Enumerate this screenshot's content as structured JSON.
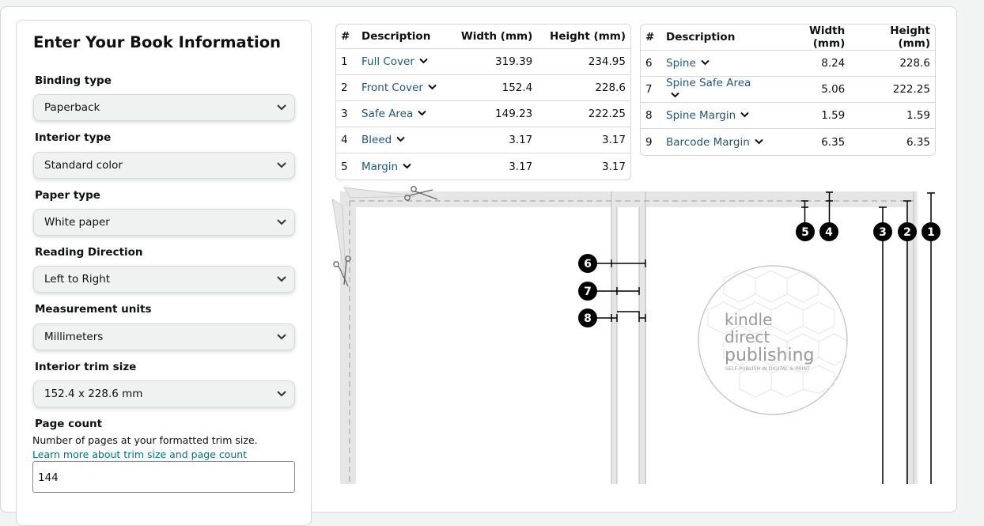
{
  "form": {
    "title": "Enter Your Book Information",
    "fields": [
      {
        "label": "Binding type",
        "value": "Paperback"
      },
      {
        "label": "Interior type",
        "value": "Standard color"
      },
      {
        "label": "Paper type",
        "value": "White paper"
      },
      {
        "label": "Reading Direction",
        "value": "Left to Right"
      },
      {
        "label": "Measurement units",
        "value": "Millimeters"
      },
      {
        "label": "Interior trim size",
        "value": "152.4 x 228.6 mm"
      }
    ],
    "page_count": {
      "label": "Page count",
      "help": "Number of pages at your formatted trim size.",
      "link": "Learn more about trim size and page count",
      "value": "144"
    }
  },
  "table_headers": {
    "num": "#",
    "desc": "Description",
    "width": "Width (mm)",
    "height": "Height (mm)"
  },
  "table_left": [
    {
      "num": "1",
      "desc": "Full Cover",
      "width": "319.39",
      "height": "234.95"
    },
    {
      "num": "2",
      "desc": "Front Cover",
      "width": "152.4",
      "height": "228.6"
    },
    {
      "num": "3",
      "desc": "Safe Area",
      "width": "149.23",
      "height": "222.25"
    },
    {
      "num": "4",
      "desc": "Bleed",
      "width": "3.17",
      "height": "3.17"
    },
    {
      "num": "5",
      "desc": "Margin",
      "width": "3.17",
      "height": "3.17"
    }
  ],
  "table_right": [
    {
      "num": "6",
      "desc": "Spine",
      "width": "8.24",
      "height": "228.6"
    },
    {
      "num": "7",
      "desc": "Spine Safe Area",
      "width": "5.06",
      "height": "222.25"
    },
    {
      "num": "8",
      "desc": "Spine Margin",
      "width": "1.59",
      "height": "1.59"
    },
    {
      "num": "9",
      "desc": "Barcode Margin",
      "width": "6.35",
      "height": "6.35"
    }
  ],
  "diagram": {
    "markers": [
      "1",
      "2",
      "3",
      "4",
      "5",
      "6",
      "7",
      "8"
    ],
    "logo": {
      "line1": "kindle",
      "line2": "direct",
      "line3": "publishing",
      "tagline": "SELF-PUBLISH IN DIGITAL & PRINT"
    }
  }
}
